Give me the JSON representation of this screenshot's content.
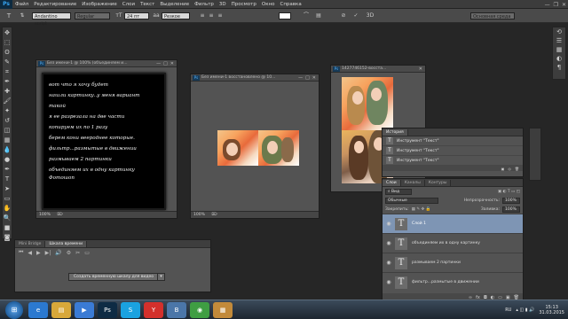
{
  "app": {
    "logo": "Ps"
  },
  "menu": [
    "Файл",
    "Редактирование",
    "Изображение",
    "Слои",
    "Текст",
    "Выделение",
    "Фильтр",
    "3D",
    "Просмотр",
    "Окно",
    "Справка"
  ],
  "window_controls": {
    "minimize": "—",
    "restore": "❐",
    "close": "✕"
  },
  "options": {
    "tool_icon": "T",
    "font_family": "Andantino script",
    "font_style": "Regular",
    "font_size": "24 пт",
    "anti_alias": "Резкое",
    "workspace": "Основная среда",
    "text_color": "#ffffff"
  },
  "tools": [
    "move-tool",
    "marquee-tool",
    "lasso-tool",
    "quick-select-tool",
    "crop-tool",
    "eyedropper-tool",
    "healing-brush-tool",
    "brush-tool",
    "clone-stamp-tool",
    "history-brush-tool",
    "eraser-tool",
    "gradient-tool",
    "blur-tool",
    "dodge-tool",
    "pen-tool",
    "type-tool",
    "path-select-tool",
    "shape-tool",
    "hand-tool",
    "zoom-tool",
    "color-swatches",
    "quick-mask"
  ],
  "tool_glyphs": [
    "✥",
    "⬚",
    "ʘ",
    "✎",
    "⌗",
    "✒",
    "✚",
    "🖌",
    "✦",
    "↺",
    "◫",
    "▦",
    "💧",
    "●",
    "✒",
    "T",
    "➤",
    "▭",
    "✋",
    "🔍",
    "■",
    "◙"
  ],
  "documents": [
    {
      "title": "Без имени-1 @ 100% (объединяем и...",
      "zoom": "100%",
      "text_lines": [
        "вот что я хочу будет",
        "нашли картинку..у меня вариант",
        "такой",
        "я ее разрезала на две части",
        "копируем их по 1 разу",
        "берем кони веероднее которые.",
        "фильтр...размытые в движении",
        "размываем 2 партинки",
        "объединяем их в одну картинку",
        "Фотошоп"
      ]
    },
    {
      "title": "Без имени-1 восстановлено @ 10...",
      "zoom": "100%"
    },
    {
      "title": "1427746152-восста...",
      "zoom": ""
    }
  ],
  "history": {
    "tabs": [
      "История"
    ],
    "rows": [
      {
        "label": "Инструмент \"Текст\""
      },
      {
        "label": "Инструмент \"Текст\""
      },
      {
        "label": "Инструмент \"Текст\""
      },
      {
        "label": "Инструмент \"Текст\""
      }
    ]
  },
  "layers": {
    "tabs": [
      "Слои",
      "Каналы",
      "Контуры"
    ],
    "kind": "Вид",
    "blend_mode": "Обычные",
    "opacity_label": "Непрозрачность:",
    "opacity": "100%",
    "lock_label": "Закрепить:",
    "fill_label": "Заливка:",
    "fill": "100%",
    "items": [
      {
        "name": "Слой 1",
        "selected": true
      },
      {
        "name": "объединяем их в одну картинку",
        "selected": false
      },
      {
        "name": "размываем 2 партинки",
        "selected": false
      },
      {
        "name": "фильтр...размытые в движении",
        "selected": false
      }
    ]
  },
  "timeline": {
    "tabs": [
      "Mini Bridge",
      "Шкала времени"
    ],
    "create_button": "Создать временную шкалу для видео"
  },
  "taskbar": {
    "start": "⊞",
    "apps": [
      {
        "name": "ie",
        "glyph": "e",
        "color": "#2b79d0"
      },
      {
        "name": "explorer",
        "glyph": "▤",
        "color": "#d8a83a"
      },
      {
        "name": "media",
        "glyph": "▶",
        "color": "#3a7bd5"
      },
      {
        "name": "photoshop",
        "glyph": "Ps",
        "color": "#0e2b44"
      },
      {
        "name": "skype",
        "glyph": "S",
        "color": "#1aa2e0"
      },
      {
        "name": "yandex",
        "glyph": "Y",
        "color": "#d3302c"
      },
      {
        "name": "vk",
        "glyph": "В",
        "color": "#4b76a8"
      },
      {
        "name": "chrome",
        "glyph": "◉",
        "color": "#3f9e43"
      },
      {
        "name": "files",
        "glyph": "▦",
        "color": "#c28a3a"
      }
    ],
    "language": "RU",
    "time": "15:13",
    "date": "31.03.2015"
  }
}
